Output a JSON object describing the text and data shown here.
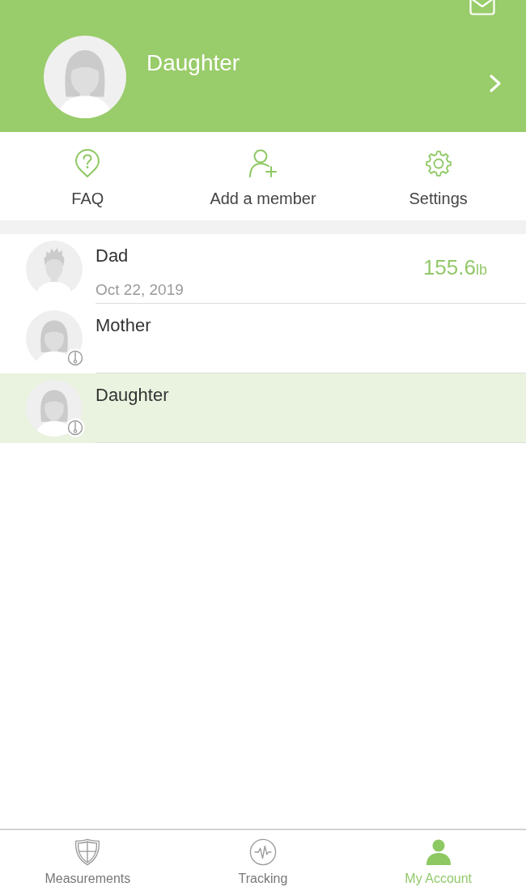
{
  "header": {
    "name": "Daughter",
    "avatar": {
      "kind": "female"
    }
  },
  "actions": [
    {
      "kind": "faq",
      "label": "FAQ"
    },
    {
      "kind": "add_member",
      "label": "Add a member"
    },
    {
      "kind": "settings",
      "label": "Settings"
    }
  ],
  "members": [
    {
      "name": "Dad",
      "avatar": {
        "kind": "male"
      },
      "date": "Oct 22, 2019",
      "weight": "155.6",
      "unit": "lb",
      "flagged": false,
      "selected": false
    },
    {
      "name": "Mother",
      "avatar": {
        "kind": "female"
      },
      "flagged": true,
      "selected": false
    },
    {
      "name": "Daughter",
      "avatar": {
        "kind": "female"
      },
      "flagged": true,
      "selected": true
    }
  ],
  "tabs": [
    {
      "kind": "measurements",
      "label": "Measurements",
      "selected": false
    },
    {
      "kind": "tracking",
      "label": "Tracking",
      "selected": false
    },
    {
      "kind": "account",
      "label": "My Account",
      "selected": true
    }
  ]
}
